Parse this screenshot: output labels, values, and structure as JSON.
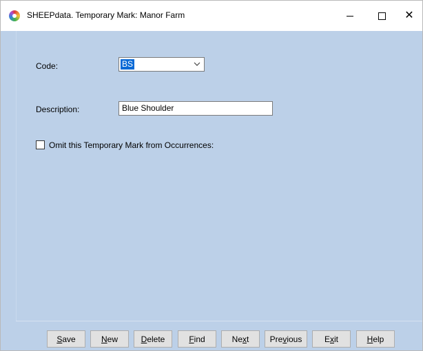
{
  "window": {
    "title": "SHEEPdata. Temporary Mark: Manor Farm",
    "close_glyph": "✕"
  },
  "form": {
    "code_label": "Code:",
    "code_value": "BS",
    "description_label": "Description:",
    "description_value": "Blue Shoulder",
    "omit_label": "Omit this Temporary Mark from Occurrences:",
    "omit_checked": false
  },
  "buttons": {
    "save": {
      "hotkey": "S",
      "rest": "ave"
    },
    "new": {
      "hotkey": "N",
      "rest": "ew"
    },
    "delete": {
      "hotkey": "D",
      "rest": "elete"
    },
    "find": {
      "hotkey": "F",
      "rest": "ind"
    },
    "next": {
      "pre": "Ne",
      "hotkey": "x",
      "rest": "t"
    },
    "previous": {
      "pre": "Pre",
      "hotkey": "v",
      "rest": "ious"
    },
    "exit": {
      "pre": "E",
      "hotkey": "x",
      "rest": "it"
    },
    "help": {
      "hotkey": "H",
      "rest": "elp"
    }
  },
  "icons": {
    "app": "sheepdata-app-icon",
    "minimize": "minimize-icon",
    "maximize": "maximize-icon",
    "close": "close-icon",
    "dropdown": "chevron-down-icon"
  },
  "colors": {
    "client_background": "#bcd0e8",
    "selection_highlight": "#0a6ad6"
  }
}
